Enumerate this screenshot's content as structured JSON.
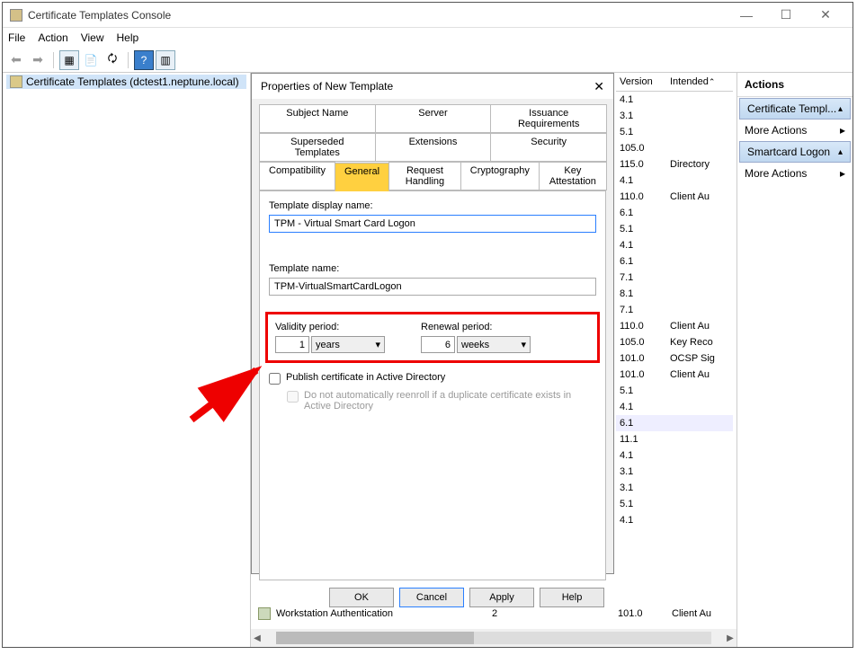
{
  "window": {
    "title": "Certificate Templates Console",
    "min": "—",
    "max": "☐",
    "close": "✕"
  },
  "menu": {
    "file": "File",
    "action": "Action",
    "view": "View",
    "help": "Help"
  },
  "tree": {
    "node": "Certificate Templates (dctest1.neptune.local)"
  },
  "dialog": {
    "title": "Properties of New Template",
    "close": "✕",
    "tabs_row1": {
      "subject": "Subject Name",
      "server": "Server",
      "issuance": "Issuance Requirements"
    },
    "tabs_row2": {
      "superseded": "Superseded Templates",
      "extensions": "Extensions",
      "security": "Security"
    },
    "tabs_row3": {
      "compat": "Compatibility",
      "general": "General",
      "request": "Request Handling",
      "crypto": "Cryptography",
      "keyatt": "Key Attestation"
    },
    "display_label": "Template display name:",
    "display_value": "TPM - Virtual Smart Card Logon",
    "name_label": "Template name:",
    "name_value": "TPM-VirtualSmartCardLogon",
    "validity_label": "Validity period:",
    "validity_num": "1",
    "validity_unit": "years",
    "renewal_label": "Renewal period:",
    "renewal_num": "6",
    "renewal_unit": "weeks",
    "publish": "Publish certificate in Active Directory",
    "noreenroll": "Do not automatically reenroll if a duplicate certificate exists in Active Directory",
    "ok": "OK",
    "cancel": "Cancel",
    "apply": "Apply",
    "help": "Help"
  },
  "list": {
    "h1": "Version",
    "h2": "Intended",
    "rows": [
      {
        "v": "4.1",
        "i": ""
      },
      {
        "v": "3.1",
        "i": ""
      },
      {
        "v": "5.1",
        "i": ""
      },
      {
        "v": "105.0",
        "i": ""
      },
      {
        "v": "115.0",
        "i": "Directory"
      },
      {
        "v": "4.1",
        "i": ""
      },
      {
        "v": "110.0",
        "i": "Client Au"
      },
      {
        "v": "6.1",
        "i": ""
      },
      {
        "v": "5.1",
        "i": ""
      },
      {
        "v": "4.1",
        "i": ""
      },
      {
        "v": "6.1",
        "i": ""
      },
      {
        "v": "7.1",
        "i": ""
      },
      {
        "v": "8.1",
        "i": ""
      },
      {
        "v": "7.1",
        "i": ""
      },
      {
        "v": "110.0",
        "i": "Client Au"
      },
      {
        "v": "105.0",
        "i": "Key Reco"
      },
      {
        "v": "101.0",
        "i": "OCSP Sig"
      },
      {
        "v": "101.0",
        "i": "Client Au"
      },
      {
        "v": "5.1",
        "i": ""
      },
      {
        "v": "4.1",
        "i": ""
      },
      {
        "v": "6.1",
        "i": ""
      },
      {
        "v": "11.1",
        "i": ""
      },
      {
        "v": "4.1",
        "i": ""
      },
      {
        "v": "3.1",
        "i": ""
      },
      {
        "v": "3.1",
        "i": ""
      },
      {
        "v": "5.1",
        "i": ""
      },
      {
        "v": "4.1",
        "i": ""
      }
    ]
  },
  "bottom": {
    "name": "Workstation Authentication",
    "num": "2",
    "ver": "101.0",
    "int": "Client Au"
  },
  "actions": {
    "title": "Actions",
    "certtempl": "Certificate Templ...",
    "smartcard": "Smartcard Logon",
    "more": "More Actions"
  }
}
